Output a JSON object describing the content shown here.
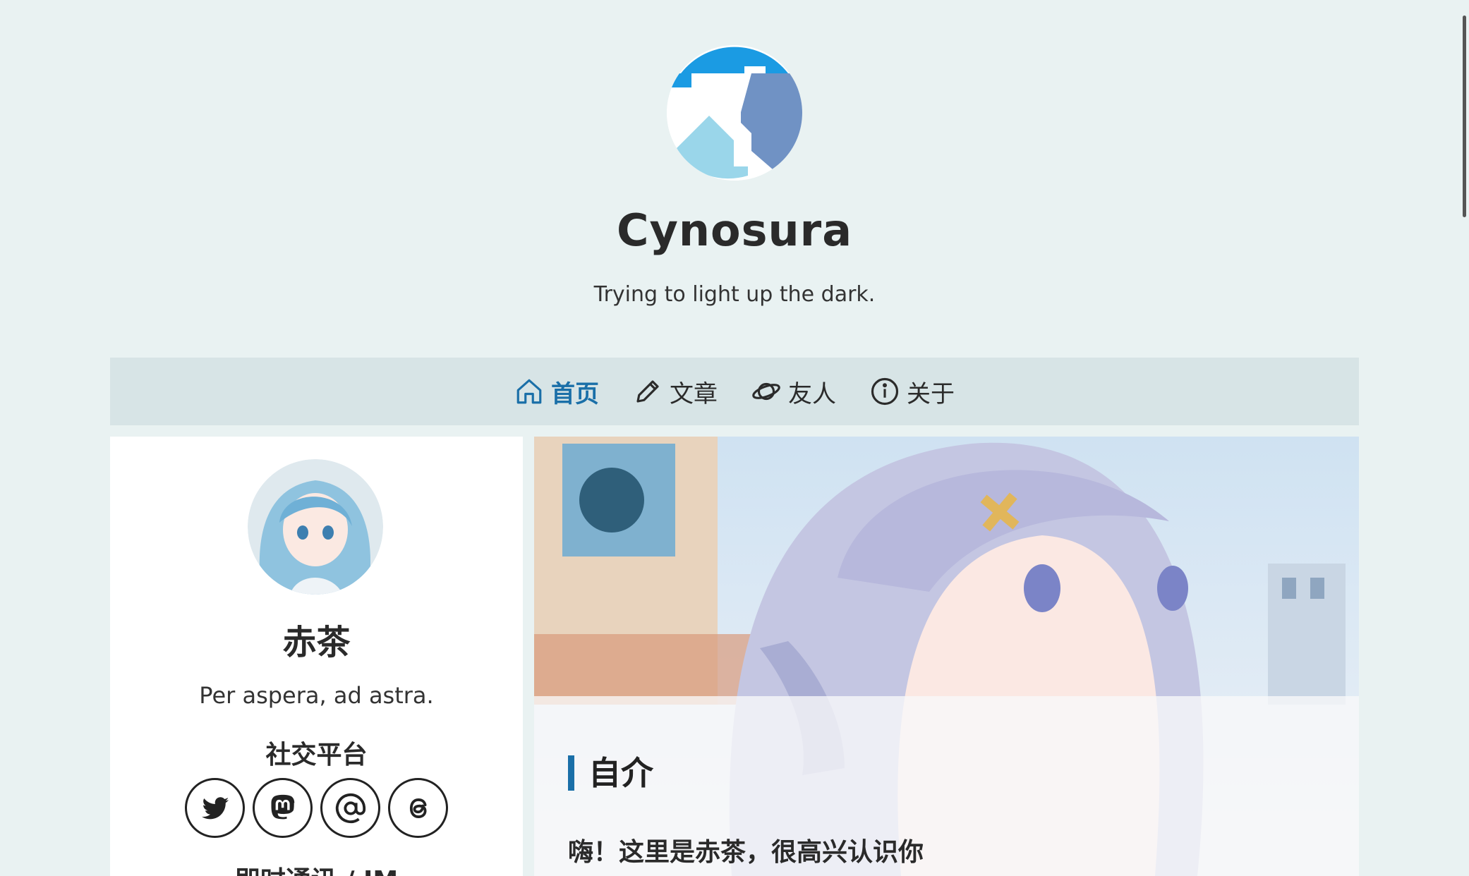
{
  "header": {
    "title": "Cynosura",
    "subtitle": "Trying to light up the dark."
  },
  "nav": {
    "items": [
      {
        "label": "首页",
        "icon": "home-icon",
        "active": true
      },
      {
        "label": "文章",
        "icon": "pencil-icon",
        "active": false
      },
      {
        "label": "友人",
        "icon": "planet-icon",
        "active": false
      },
      {
        "label": "关于",
        "icon": "info-icon",
        "active": false
      }
    ]
  },
  "profile": {
    "name": "赤茶",
    "motto": "Per aspera, ad astra.",
    "social_title": "社交平台",
    "social_links": [
      {
        "icon": "twitter-icon"
      },
      {
        "icon": "mastodon-icon"
      },
      {
        "icon": "at-icon"
      },
      {
        "icon": "threads-icon"
      }
    ],
    "im_title": "即时通讯 / IM"
  },
  "main": {
    "section_title": "自介",
    "intro": "嗨！这里是赤茶，很高兴认识你"
  },
  "colors": {
    "background": "#e9f2f2",
    "nav_bg": "#d7e4e6",
    "accent": "#1a6fa8"
  }
}
